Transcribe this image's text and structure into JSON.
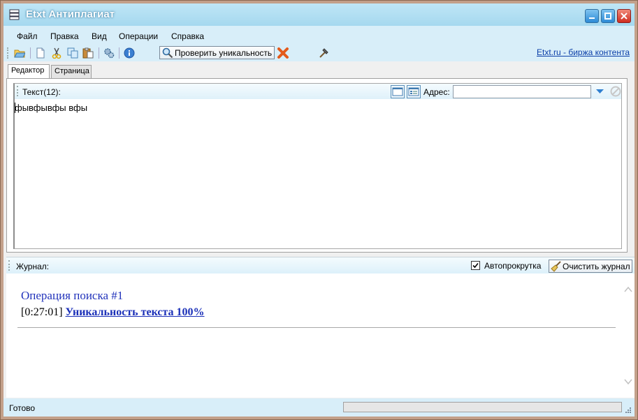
{
  "window": {
    "title": "Etxt Антиплагиат"
  },
  "menu": {
    "items": [
      "Файл",
      "Правка",
      "Вид",
      "Операции",
      "Справка"
    ]
  },
  "toolbar": {
    "check_button_label": "Проверить уникальность",
    "site_link": "Etxt.ru - биржа контента",
    "icons": [
      "open-folder-icon",
      "new-document-icon",
      "cut-icon",
      "copy-icon",
      "paste-icon",
      "settings-icon",
      "info-icon",
      "search-icon",
      "cancel-icon",
      "hammer-icon"
    ]
  },
  "tabs": [
    {
      "label": "Редактор",
      "active": true
    },
    {
      "label": "Страница",
      "active": false
    }
  ],
  "editor": {
    "header_label": "Текст(12):",
    "address_label": "Адрес:",
    "address_value": "",
    "text": "фывфывфы вфы"
  },
  "journal": {
    "label": "Журнал:",
    "autoscroll_label": "Автопрокрутка",
    "autoscroll_checked": true,
    "clear_button_label": "Очистить журнал",
    "operation_title": "Операция поиска #1",
    "entry_time": "[0:27:01]",
    "entry_result": "Уникальность текста 100%"
  },
  "status": {
    "text": "Готово",
    "progress": 0
  },
  "colors": {
    "title_bar": "#a5d8ef",
    "menubar": "#d8eef9",
    "link": "#0b3ea8",
    "journal_title": "#2233bb"
  }
}
